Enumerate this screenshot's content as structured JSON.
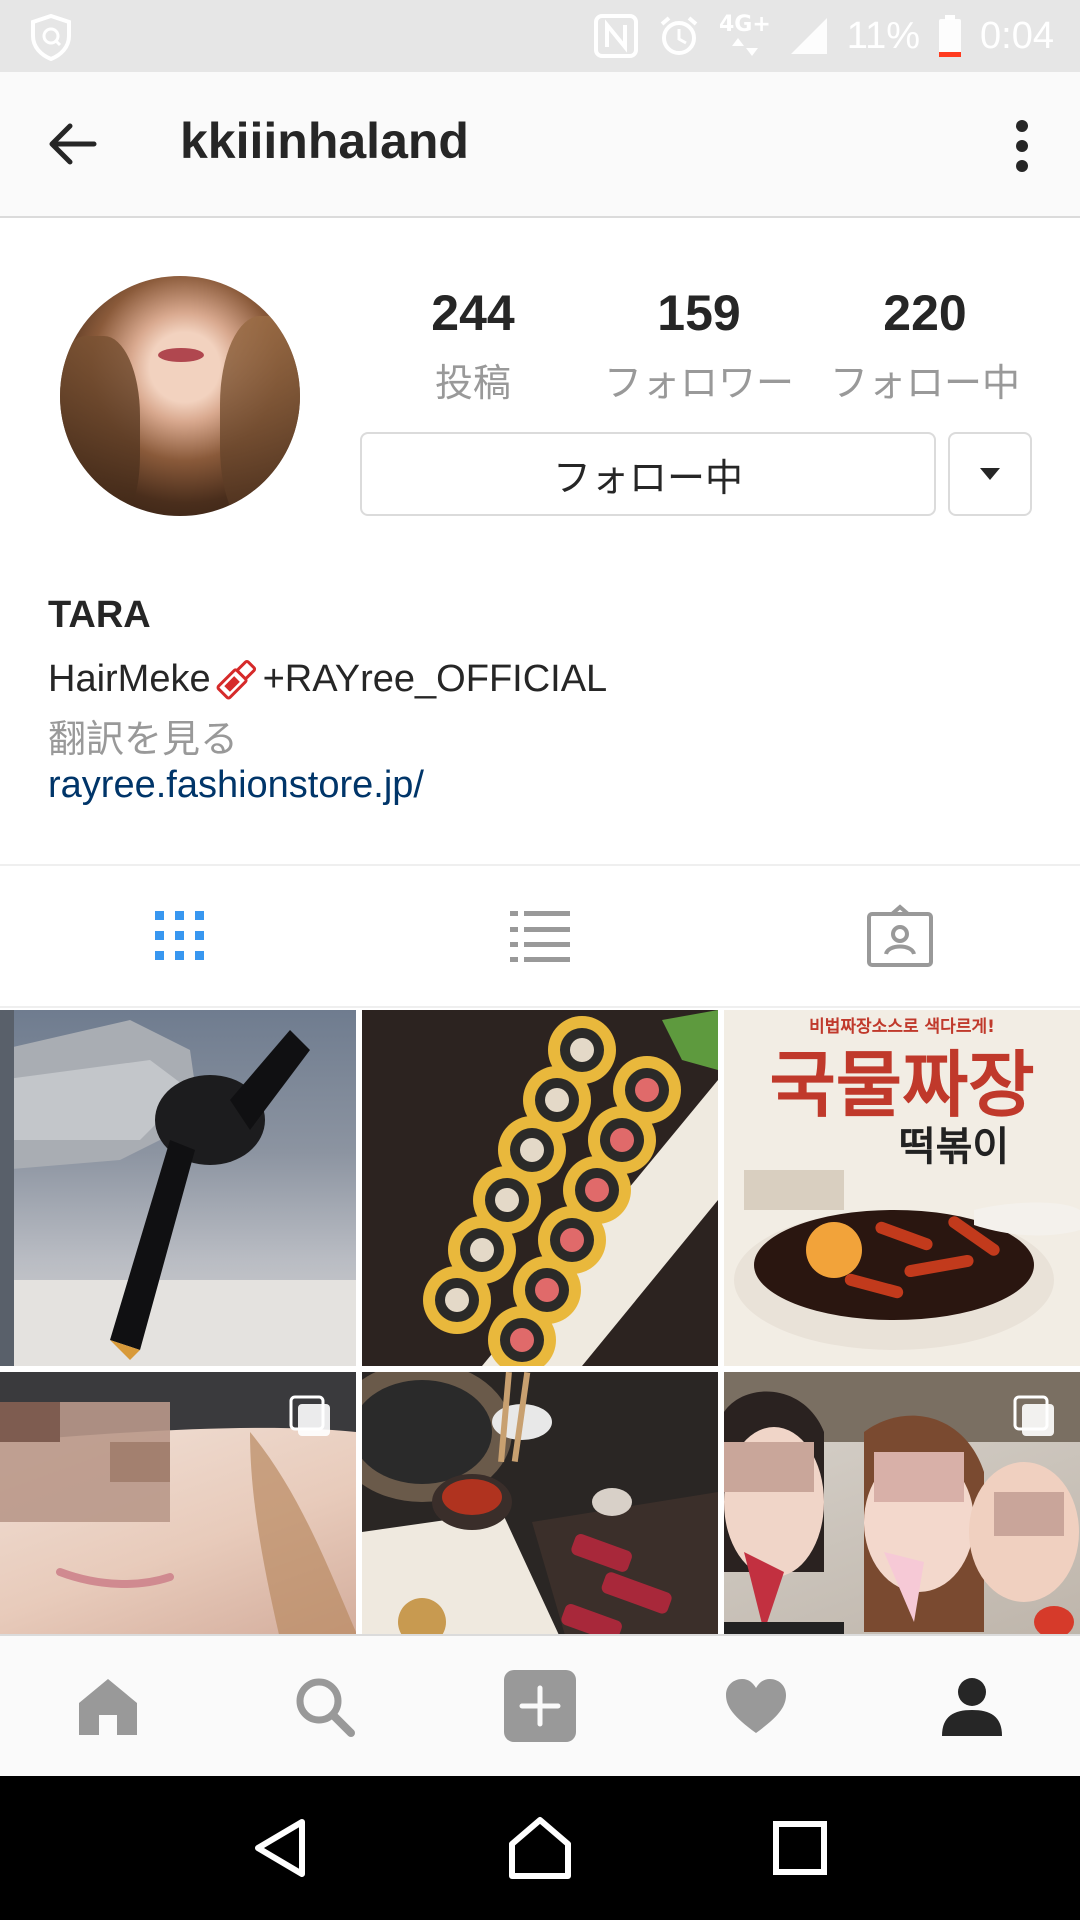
{
  "status_bar": {
    "network_type": "4G+",
    "battery_percent": "11%",
    "time": "0:04",
    "icons": [
      "shield-icon",
      "nfc-icon",
      "alarm-icon",
      "signal-icon",
      "battery-icon"
    ]
  },
  "header": {
    "username": "kkiiinhaland",
    "back_icon": "arrow-left-icon",
    "more_icon": "more-vertical-icon"
  },
  "profile": {
    "stats": [
      {
        "value": "244",
        "label": "投稿"
      },
      {
        "value": "159",
        "label": "フォロワー"
      },
      {
        "value": "220",
        "label": "フォロー中"
      }
    ],
    "follow_button": "フォロー中",
    "name": "TARA",
    "bio_prefix": "HairMeke",
    "bio_suffix": "+RAYree_OFFICIAL",
    "translate": "翻訳を見る",
    "website": "rayree.fashionstore.jp/"
  },
  "tabs": [
    {
      "name": "grid-view",
      "icon": "grid-icon",
      "active": true
    },
    {
      "name": "list-view",
      "icon": "list-icon",
      "active": false
    },
    {
      "name": "tagged",
      "icon": "tagged-person-icon",
      "active": false
    }
  ],
  "posts": {
    "tile3_text_top": "비법짜장소스로 색다르게!",
    "tile3_text_main": "국물짜장",
    "tile3_text_sub": "떡볶이"
  },
  "bottom_nav": [
    {
      "name": "home",
      "icon": "home-icon"
    },
    {
      "name": "search",
      "icon": "search-icon"
    },
    {
      "name": "add",
      "icon": "plus-square-icon"
    },
    {
      "name": "activity",
      "icon": "heart-icon"
    },
    {
      "name": "profile",
      "icon": "person-icon",
      "active": true
    }
  ],
  "colors": {
    "accent_blue": "#3897f0",
    "link": "#003569",
    "muted": "#999999",
    "text": "#262626"
  }
}
